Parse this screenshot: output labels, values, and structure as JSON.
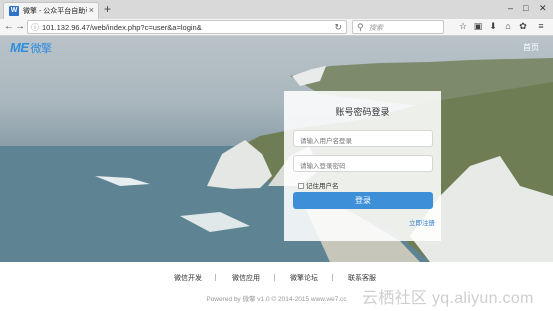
{
  "browser": {
    "tab_title": "微擎 - 公众平台自助引擎 - ",
    "tab_favicon_letter": "W",
    "url": "101.132.96.47/web/index.php?c=user&a=login&",
    "search_placeholder": "搜索"
  },
  "site": {
    "logo_text": "ME",
    "logo_cn": "微擎",
    "home_link": "首页",
    "brand_color": "#2f8ee0"
  },
  "login": {
    "title": "账号密码登录",
    "username_placeholder": "请输入用户名登录",
    "password_placeholder": "请输入登录密码",
    "remember_label": "记住用户名",
    "submit_label": "登录",
    "register_link": "立即注册",
    "button_color": "#3d8fd8"
  },
  "footer": {
    "links": [
      "微信开发",
      "微信应用",
      "微擎论坛",
      "联系客服"
    ],
    "copyright": "Powered by 微擎 v1.0 © 2014-2015 www.we7.cc",
    "watermark": "云栖社区 yq.aliyun.com"
  }
}
